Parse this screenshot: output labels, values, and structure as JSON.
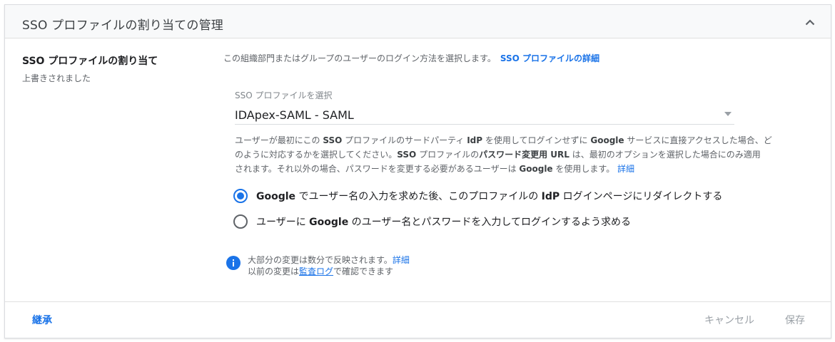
{
  "header": {
    "title": "SSO プロファイルの割り当ての管理",
    "collapse_icon": "chevron-up-icon"
  },
  "left": {
    "title": "SSO プロファイルの割り当て",
    "subtitle": "上書きされました"
  },
  "main": {
    "description": "この組織部門またはグループのユーザーのログイン方法を選択します。",
    "description_link": "SSO プロファイルの詳細",
    "select": {
      "label": "SSO プロファイルを選択",
      "value": "IDApex-SAML - SAML"
    },
    "help": {
      "line1_a": "ユーザーが最初にこの ",
      "line1_b": "SSO",
      "line1_c": " プロファイルのサードパーティ ",
      "line1_d": "IdP",
      "line1_e": " を使用してログインせずに ",
      "line1_f": "Google",
      "line1_g": " サービスに直接アクセスした場合、ど",
      "line2_a": "のように対応するかを選択してください。",
      "line2_b": "SSO",
      "line2_c": " プロファイルの",
      "line2_d": "パスワード変更用 URL",
      "line2_e": " は、最初のオプションを選択した場合にのみ適用",
      "line3_a": "されます。それ以外の場合、パスワードを変更する必要があるユーザーは ",
      "line3_b": "Google",
      "line3_c": " を使用します。",
      "link": "詳細"
    },
    "options": [
      {
        "a": "Google",
        "b": " でユーザー名の入力を求めた後、このプロファイルの ",
        "c": "IdP",
        "d": " ログインページにリダイレクトする",
        "checked": true
      },
      {
        "a": "ユーザーに ",
        "b": "Google",
        "c": " のユーザー名とパスワードを入力してログインするよう求める",
        "checked": false
      }
    ],
    "info": {
      "icon": "info-icon",
      "line1": "大部分の変更は数分で反映されます。",
      "line1_link": "詳細",
      "line2_a": "以前の変更は",
      "line2_link": "監査ログ",
      "line2_b": "で確認できます"
    }
  },
  "footer": {
    "inherit": "継承",
    "cancel": "キャンセル",
    "save": "保存"
  },
  "colors": {
    "accent": "#1a73e8",
    "disabled": "#9aa0a6",
    "header_bg": "#f8f9fa"
  }
}
